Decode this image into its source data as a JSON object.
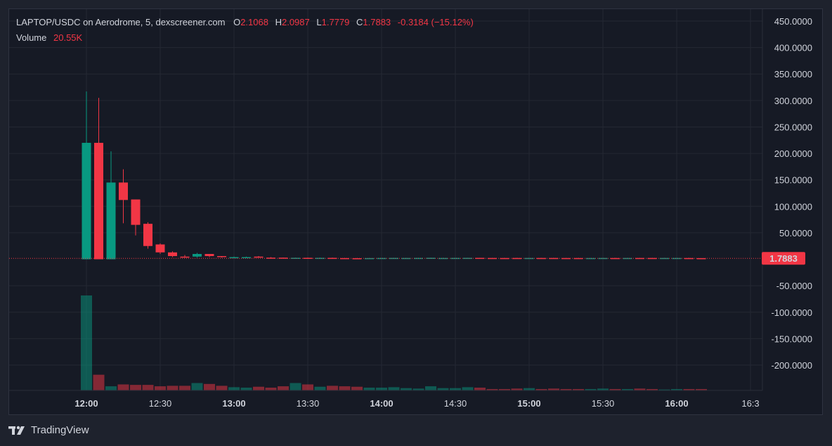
{
  "legend": {
    "symbol": "LAPTOP/USDC on Aerodrome, 5, dexscreener.com",
    "o_label": "O",
    "o_value": "2.1068",
    "h_label": "H",
    "h_value": "2.0987",
    "l_label": "L",
    "l_value": "1.7779",
    "c_label": "C",
    "c_value": "1.7883",
    "change": "-0.3184 (−15.12%)",
    "volume_label": "Volume",
    "volume_value": "20.55K"
  },
  "brand": {
    "label": "TradingView"
  },
  "colors": {
    "up": "#089981",
    "down": "#f23645",
    "background": "#161a25",
    "grid": "#242833",
    "text": "#d1d4dc"
  },
  "chart_data": {
    "type": "candlestick",
    "interval": "5m",
    "ylim": [
      -245,
      460
    ],
    "y_ticks": [
      "450.0000",
      "400.0000",
      "350.0000",
      "300.0000",
      "250.0000",
      "200.0000",
      "150.0000",
      "100.0000",
      "50.0000",
      "-50.0000",
      "-100.0000",
      "-150.0000",
      "-200.0000"
    ],
    "y_tick_values": [
      450,
      400,
      350,
      300,
      250,
      200,
      150,
      100,
      50,
      -50,
      -100,
      -150,
      -200
    ],
    "x_ticks": [
      "12:00",
      "12:30",
      "13:00",
      "13:30",
      "14:00",
      "14:30",
      "15:00",
      "15:30",
      "16:00",
      "16:3"
    ],
    "x_ticks_bold": [
      true,
      false,
      true,
      false,
      true,
      false,
      true,
      false,
      true,
      false
    ],
    "x_range": [
      "11:45",
      "16:50"
    ],
    "last_price": 1.7883,
    "last_price_label": "1.7883",
    "candles": [
      {
        "t": "12:00",
        "o": 0,
        "h": 317,
        "l": 0,
        "c": 220,
        "v": 20.55
      },
      {
        "t": "12:05",
        "o": 220,
        "h": 305,
        "l": 0,
        "c": 0,
        "v": 3.4
      },
      {
        "t": "12:10",
        "o": 0,
        "h": 204,
        "l": 0,
        "c": 145,
        "v": 0.9
      },
      {
        "t": "12:15",
        "o": 145,
        "h": 170,
        "l": 68,
        "c": 112,
        "v": 1.3
      },
      {
        "t": "12:20",
        "o": 113,
        "h": 113,
        "l": 45,
        "c": 65,
        "v": 1.2
      },
      {
        "t": "12:25",
        "o": 67,
        "h": 70,
        "l": 20,
        "c": 25,
        "v": 1.2
      },
      {
        "t": "12:30",
        "o": 28,
        "h": 30,
        "l": 10,
        "c": 13,
        "v": 0.9
      },
      {
        "t": "12:35",
        "o": 13,
        "h": 15,
        "l": 4,
        "c": 6,
        "v": 1.0
      },
      {
        "t": "12:40",
        "o": 5,
        "h": 8,
        "l": 3,
        "c": 4,
        "v": 1.0
      },
      {
        "t": "12:45",
        "o": 5,
        "h": 12,
        "l": 3,
        "c": 10,
        "v": 1.6
      },
      {
        "t": "12:50",
        "o": 10,
        "h": 10,
        "l": 4,
        "c": 6,
        "v": 1.4
      },
      {
        "t": "12:55",
        "o": 6,
        "h": 6,
        "l": 3,
        "c": 4,
        "v": 1.0
      },
      {
        "t": "13:00",
        "o": 3,
        "h": 5,
        "l": 2,
        "c": 4,
        "v": 0.7
      },
      {
        "t": "13:05",
        "o": 3,
        "h": 5,
        "l": 2,
        "c": 4,
        "v": 0.6
      },
      {
        "t": "13:10",
        "o": 5,
        "h": 6,
        "l": 3,
        "c": 3,
        "v": 0.8
      },
      {
        "t": "13:15",
        "o": 3,
        "h": 4,
        "l": 2,
        "c": 2.5,
        "v": 0.6
      },
      {
        "t": "13:20",
        "o": 3,
        "h": 3,
        "l": 2,
        "c": 2.2,
        "v": 0.9
      },
      {
        "t": "13:25",
        "o": 2,
        "h": 3,
        "l": 1.8,
        "c": 2.7,
        "v": 1.6
      },
      {
        "t": "13:30",
        "o": 2.7,
        "h": 3,
        "l": 1.8,
        "c": 2.2,
        "v": 1.3
      },
      {
        "t": "13:35",
        "o": 2,
        "h": 3,
        "l": 1.8,
        "c": 2.6,
        "v": 0.8
      },
      {
        "t": "13:40",
        "o": 2.6,
        "h": 3,
        "l": 2,
        "c": 2.2,
        "v": 1.0
      },
      {
        "t": "13:45",
        "o": 2.2,
        "h": 2.5,
        "l": 1.9,
        "c": 2.0,
        "v": 0.9
      },
      {
        "t": "13:50",
        "o": 2.0,
        "h": 2.4,
        "l": 1.8,
        "c": 1.9,
        "v": 0.8
      },
      {
        "t": "13:55",
        "o": 2.0,
        "h": 2.3,
        "l": 1.8,
        "c": 2.2,
        "v": 0.6
      },
      {
        "t": "14:00",
        "o": 2.0,
        "h": 2.6,
        "l": 1.8,
        "c": 2.4,
        "v": 0.6
      },
      {
        "t": "14:05",
        "o": 2.1,
        "h": 2.6,
        "l": 1.9,
        "c": 2.5,
        "v": 0.7
      },
      {
        "t": "14:10",
        "o": 2.2,
        "h": 2.5,
        "l": 1.9,
        "c": 2.4,
        "v": 0.5
      },
      {
        "t": "14:15",
        "o": 2.1,
        "h": 2.6,
        "l": 1.9,
        "c": 2.5,
        "v": 0.4
      },
      {
        "t": "14:20",
        "o": 2.0,
        "h": 2.8,
        "l": 1.8,
        "c": 2.7,
        "v": 0.9
      },
      {
        "t": "14:25",
        "o": 2.1,
        "h": 2.5,
        "l": 1.9,
        "c": 2.4,
        "v": 0.5
      },
      {
        "t": "14:30",
        "o": 2.1,
        "h": 2.6,
        "l": 1.9,
        "c": 2.5,
        "v": 0.5
      },
      {
        "t": "14:35",
        "o": 2.1,
        "h": 2.7,
        "l": 1.9,
        "c": 2.6,
        "v": 0.7
      },
      {
        "t": "14:40",
        "o": 2.6,
        "h": 2.7,
        "l": 2.0,
        "c": 2.1,
        "v": 0.6
      },
      {
        "t": "14:45",
        "o": 2.4,
        "h": 2.6,
        "l": 2.0,
        "c": 2.1,
        "v": 0.3
      },
      {
        "t": "14:50",
        "o": 2.3,
        "h": 2.5,
        "l": 2.0,
        "c": 2.1,
        "v": 0.3
      },
      {
        "t": "14:55",
        "o": 2.4,
        "h": 2.6,
        "l": 2.0,
        "c": 2.1,
        "v": 0.4
      },
      {
        "t": "15:00",
        "o": 2.0,
        "h": 2.6,
        "l": 1.9,
        "c": 2.4,
        "v": 0.5
      },
      {
        "t": "15:05",
        "o": 2.4,
        "h": 2.5,
        "l": 2.0,
        "c": 2.1,
        "v": 0.3
      },
      {
        "t": "15:10",
        "o": 2.4,
        "h": 2.6,
        "l": 2.0,
        "c": 2.1,
        "v": 0.4
      },
      {
        "t": "15:15",
        "o": 2.3,
        "h": 2.5,
        "l": 2.0,
        "c": 2.1,
        "v": 0.3
      },
      {
        "t": "15:20",
        "o": 2.3,
        "h": 2.5,
        "l": 2.0,
        "c": 2.0,
        "v": 0.3
      },
      {
        "t": "15:25",
        "o": 2.0,
        "h": 2.4,
        "l": 1.9,
        "c": 2.3,
        "v": 0.3
      },
      {
        "t": "15:30",
        "o": 2.0,
        "h": 2.5,
        "l": 1.9,
        "c": 2.4,
        "v": 0.4
      },
      {
        "t": "15:35",
        "o": 2.3,
        "h": 2.5,
        "l": 2.0,
        "c": 2.1,
        "v": 0.3
      },
      {
        "t": "15:40",
        "o": 2.0,
        "h": 2.5,
        "l": 1.9,
        "c": 2.4,
        "v": 0.3
      },
      {
        "t": "15:45",
        "o": 2.4,
        "h": 2.5,
        "l": 2.0,
        "c": 2.1,
        "v": 0.4
      },
      {
        "t": "15:50",
        "o": 2.4,
        "h": 2.5,
        "l": 2.0,
        "c": 2.1,
        "v": 0.3
      },
      {
        "t": "15:55",
        "o": 2.0,
        "h": 2.5,
        "l": 1.9,
        "c": 2.4,
        "v": 0.2
      },
      {
        "t": "16:00",
        "o": 2.0,
        "h": 2.5,
        "l": 1.9,
        "c": 2.4,
        "v": 0.3
      },
      {
        "t": "16:05",
        "o": 2.3,
        "h": 2.5,
        "l": 1.9,
        "c": 2.1,
        "v": 0.3
      },
      {
        "t": "16:10",
        "o": 2.1068,
        "h": 2.0987,
        "l": 1.7779,
        "c": 1.7883,
        "v": 0.3
      }
    ]
  }
}
